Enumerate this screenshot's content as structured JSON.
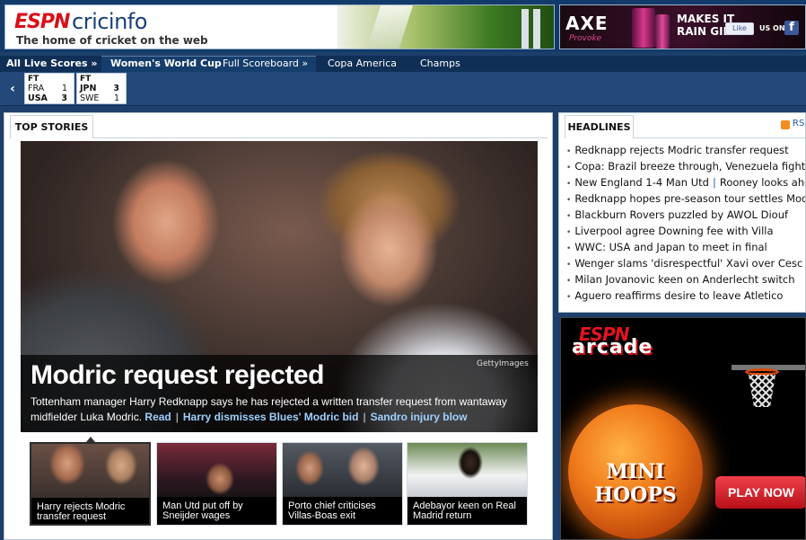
{
  "header": {
    "logo_espn": "ESPN",
    "logo_cricinfo": "cricinfo",
    "tagline": "The home of cricket on the web"
  },
  "ad_axe": {
    "brand": "AXE",
    "sub": "Provoke",
    "headline": "MAKES IT RAIN GIRLS",
    "like_label": "Like",
    "us_on": "US ON",
    "fb_icon": "f"
  },
  "nav": {
    "live": "All Live Scores »",
    "wwc": "Women's World Cup",
    "full_scoreboard": "Full Scoreboard »",
    "copa": "Copa America",
    "champs": "Champs"
  },
  "scores": {
    "prev_icon": "‹",
    "matches": [
      {
        "status": "FT",
        "team1": "FRA",
        "score1": "1",
        "team2": "USA",
        "score2": "3"
      },
      {
        "status": "FT",
        "team1": "JPN",
        "score1": "3",
        "team2": "SWE",
        "score2": "1"
      }
    ]
  },
  "main": {
    "tab_label": "TOP STORIES",
    "hero": {
      "title": "Modric request rejected",
      "credit": "GettyImages",
      "summary": "Tottenham manager Harry Redknapp says he has rejected a written transfer request from wantaway",
      "summary2": "midfielder Luka Modric.",
      "read": "Read",
      "link1": "Harry dismisses Blues' Modric bid",
      "link2": "Sandro injury blow"
    },
    "thumbs": [
      {
        "caption": "Harry rejects Modric transfer request"
      },
      {
        "caption": "Man Utd put off by Sneijder wages"
      },
      {
        "caption": "Porto chief criticises Villas-Boas exit"
      },
      {
        "caption": "Adebayor keen on Real Madrid return"
      }
    ]
  },
  "headlines": {
    "tab_label": "HEADLINES",
    "rss_label": "RS",
    "items": [
      "Redknapp rejects Modric transfer request",
      "Copa: Brazil breeze through, Venezuela fight",
      "New England 1-4 Man Utd",
      "Redknapp hopes pre-season tour settles Mod",
      "Blackburn Rovers puzzled by AWOL Diouf",
      "Liverpool agree Downing fee with Villa",
      "WWC: USA and Japan to meet in final",
      "Wenger slams 'disrespectful' Xavi over Cesc",
      "Milan Jovanovic keen on Anderlecht switch",
      "Aguero reaffirms desire to leave Atletico"
    ],
    "item3_extra": "Rooney looks ahe"
  },
  "arcade": {
    "espn": "ESPN",
    "word": "arcade",
    "game_title": "MINI HOOPS",
    "play": "PLAY NOW"
  }
}
